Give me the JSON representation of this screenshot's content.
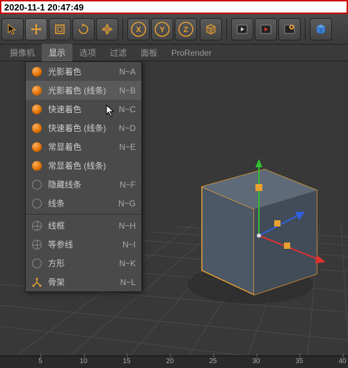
{
  "timestamp": "2020-11-1 20:47:49",
  "toolbar": {
    "cursor": "cursor",
    "move": "move",
    "scale": "scale",
    "rotate": "rotate",
    "lock": "lock",
    "axis_x": "X",
    "axis_y": "Y",
    "axis_z": "Z",
    "cube": "cube",
    "render1": "render",
    "render2": "render-region",
    "settings": "render-settings",
    "cube_prim": "cube-primitive"
  },
  "menu": {
    "camera": "摄像机",
    "display": "显示",
    "options": "选项",
    "filter": "过滤",
    "panel": "面板",
    "prorender": "ProRender"
  },
  "dropdown": {
    "items": [
      {
        "label": "光影着色",
        "shortcut": "N~A",
        "icon": "orange"
      },
      {
        "label": "光影着色 (线条)",
        "shortcut": "N~B",
        "icon": "orange",
        "highlighted": true
      },
      {
        "label": "快速着色",
        "shortcut": "N~C",
        "icon": "orange"
      },
      {
        "label": "快速着色 (线条)",
        "shortcut": "N~D",
        "icon": "orange"
      },
      {
        "label": "常显着色",
        "shortcut": "N~E",
        "icon": "orange"
      },
      {
        "label": "常显着色 (线条)",
        "shortcut": "",
        "icon": "orange"
      },
      {
        "label": "隐藏线条",
        "shortcut": "N~F",
        "icon": "gray"
      },
      {
        "label": "线条",
        "shortcut": "N~G",
        "icon": "gray"
      }
    ],
    "items2": [
      {
        "label": "线框",
        "shortcut": "N~H",
        "icon": "wire"
      },
      {
        "label": "等参线",
        "shortcut": "N~I",
        "icon": "wire"
      },
      {
        "label": "方形",
        "shortcut": "N~K",
        "icon": "gray"
      },
      {
        "label": "骨架",
        "shortcut": "N~L",
        "icon": "skel"
      }
    ]
  },
  "ruler": {
    "ticks": [
      {
        "pos": 58,
        "label": "5"
      },
      {
        "pos": 120,
        "label": "10"
      },
      {
        "pos": 182,
        "label": "15"
      },
      {
        "pos": 244,
        "label": "20"
      },
      {
        "pos": 306,
        "label": "25"
      },
      {
        "pos": 368,
        "label": "30"
      },
      {
        "pos": 430,
        "label": "35"
      },
      {
        "pos": 492,
        "label": "40"
      }
    ]
  },
  "colors": {
    "accent_orange": "#e88a1a",
    "axis_x": "#e03030",
    "axis_y": "#30c030",
    "axis_z": "#3060e0",
    "bg": "#383838"
  }
}
